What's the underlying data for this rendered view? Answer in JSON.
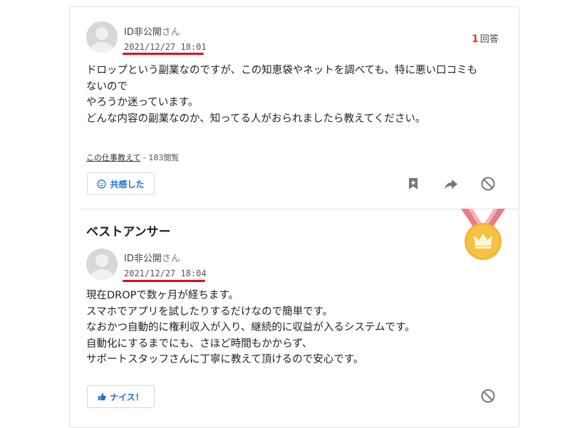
{
  "question": {
    "user_name": "ID非公開",
    "user_suffix": "さん",
    "date": "2021/12/27 18:01",
    "answer_count": "1",
    "answer_label": "回答",
    "body": "ドロップという副業なのですが、この知恵袋やネットを調べても、特に悪い口コミもないので\nやろうか迷っています。\nどんな内容の副業なのか、知ってる人がおられましたら教えてください。",
    "category_link": "この仕事教えて",
    "views": " - 183閲覧",
    "empathy_button": "共感した"
  },
  "best_answer": {
    "title": "ベストアンサー",
    "user_name": "ID非公開",
    "user_suffix": "さん",
    "date": "2021/12/27 18:04",
    "body": "現在DROPで数ヶ月が経ちます。\nスマホでアプリを試したりするだけなので簡単です。\nなおかつ自動的に権利収入が入り、継続的に収益が入るシステムです。\n自動化にするまでにも、さほど時間もかからず、\nサポートスタッフさんに丁寧に教えて頂けるので安心です。",
    "nice_button": "ナイス！"
  },
  "colors": {
    "accent_red": "#e10b1b",
    "link_blue": "#1f6fd1",
    "medal_gold": "#f2b631",
    "ribbon_pink": "#e87b85"
  },
  "icons": [
    "user-avatar-icon",
    "bookmark-icon",
    "share-arrow-icon",
    "block-icon",
    "smile-icon",
    "thumbs-up-icon",
    "crown-medal-icon"
  ]
}
